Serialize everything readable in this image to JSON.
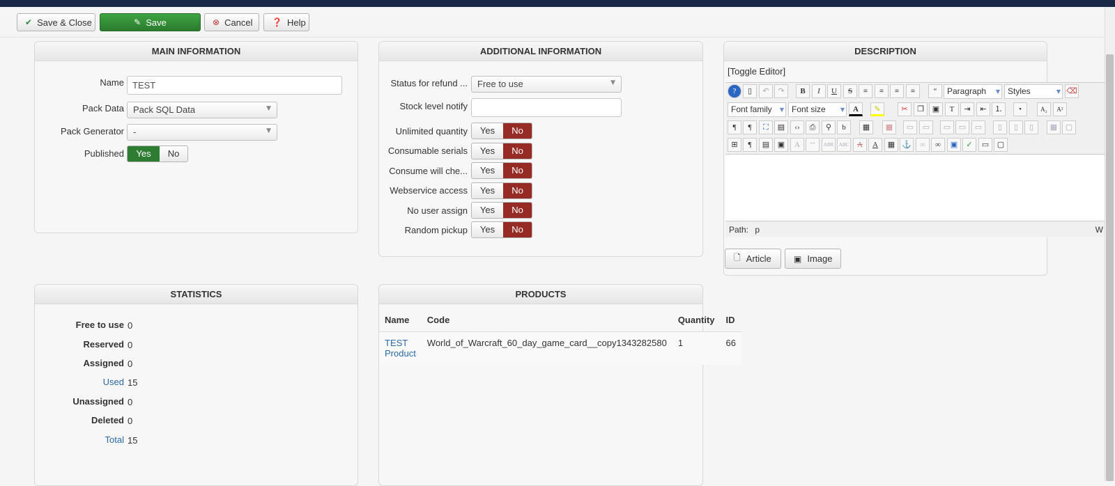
{
  "toolbar": {
    "save_close": "Save & Close",
    "save": "Save",
    "cancel": "Cancel",
    "help": "Help"
  },
  "main_info": {
    "title": "MAIN INFORMATION",
    "name_label": "Name",
    "name_value": "TEST",
    "pack_data_label": "Pack Data",
    "pack_data_value": "Pack SQL Data",
    "pack_generator_label": "Pack Generator",
    "pack_generator_value": "-",
    "published_label": "Published",
    "yes": "Yes",
    "no": "No"
  },
  "additional_info": {
    "title": "ADDITIONAL INFORMATION",
    "status_label": "Status for refund ...",
    "status_value": "Free to use",
    "stock_label": "Stock level notify",
    "stock_value": "",
    "toggles": [
      {
        "label": "Unlimited quantity",
        "yes": "Yes",
        "no": "No"
      },
      {
        "label": "Consumable serials",
        "yes": "Yes",
        "no": "No"
      },
      {
        "label": "Consume will che...",
        "yes": "Yes",
        "no": "No"
      },
      {
        "label": "Webservice access",
        "yes": "Yes",
        "no": "No"
      },
      {
        "label": "No user assign",
        "yes": "Yes",
        "no": "No"
      },
      {
        "label": "Random pickup",
        "yes": "Yes",
        "no": "No"
      }
    ]
  },
  "description": {
    "title": "DESCRIPTION",
    "toggle_editor": "[Toggle Editor]",
    "format_value": "Paragraph",
    "styles_value": "Styles",
    "font_family": "Font family",
    "font_size": "Font size",
    "path_label": "Path:",
    "path_value": "p",
    "path_right": "W",
    "article_button": "Article",
    "image_button": "Image"
  },
  "statistics": {
    "title": "STATISTICS",
    "rows": [
      {
        "label": "Free to use",
        "value": "0"
      },
      {
        "label": "Reserved",
        "value": "0"
      },
      {
        "label": "Assigned",
        "value": "0"
      },
      {
        "label": "Used",
        "value": "15"
      },
      {
        "label": "Unassigned",
        "value": "0"
      },
      {
        "label": "Deleted",
        "value": "0"
      },
      {
        "label": "Total",
        "value": "15"
      }
    ]
  },
  "products": {
    "title": "PRODUCTS",
    "headers": [
      "Name",
      "Code",
      "Quantity",
      "ID"
    ],
    "rows": [
      {
        "name": "TEST Product",
        "code": "World_of_Warcraft_60_day_game_card__copy1343282580",
        "quantity": "1",
        "id": "66"
      }
    ]
  }
}
